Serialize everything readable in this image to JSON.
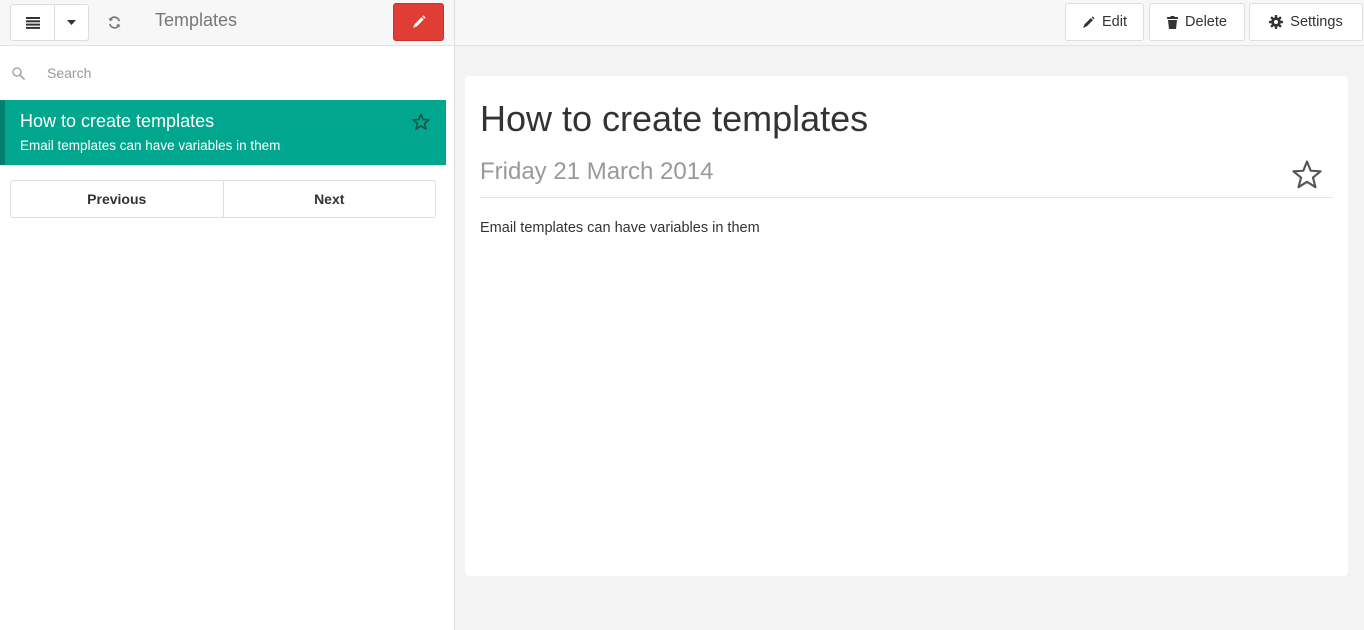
{
  "sidebar": {
    "title": "Templates",
    "search_placeholder": "Search",
    "items": [
      {
        "title": "How to create templates",
        "excerpt": "Email templates can have variables in them",
        "starred": false
      }
    ],
    "pager": {
      "previous": "Previous",
      "next": "Next"
    }
  },
  "toolbar": {
    "edit_label": "Edit",
    "delete_label": "Delete",
    "settings_label": "Settings"
  },
  "note": {
    "title": "How to create templates",
    "date": "Friday 21 March 2014",
    "body": "Email templates can have variables in them"
  },
  "colors": {
    "accent": "#00a68e",
    "compose": "#e03d35"
  },
  "icons": [
    "list-icon",
    "caret-down-icon",
    "refresh-icon",
    "pencil-icon",
    "search-icon",
    "star-outline-icon",
    "trash-icon",
    "gear-icon"
  ]
}
